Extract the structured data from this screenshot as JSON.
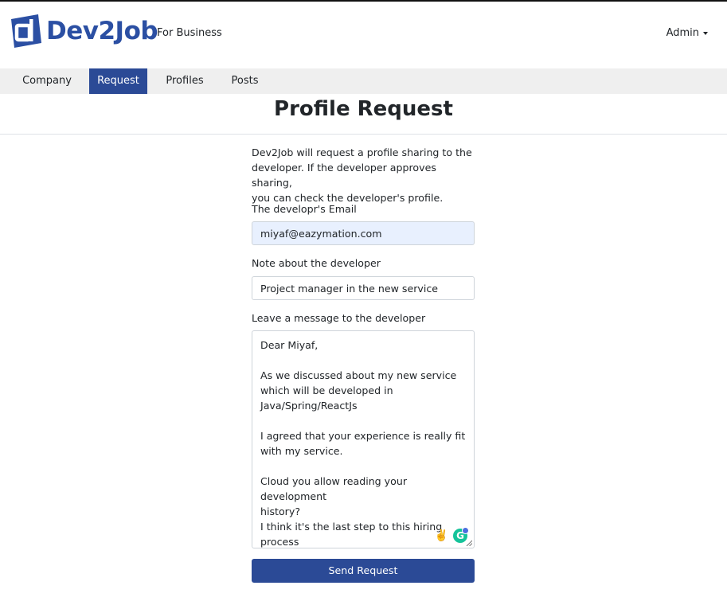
{
  "header": {
    "logo_text": "Dev2Job",
    "logo_mark": "d",
    "subtitle": "For Business",
    "admin_label": "Admin"
  },
  "nav": {
    "items": [
      {
        "label": "Company",
        "active": false
      },
      {
        "label": "Request",
        "active": true
      },
      {
        "label": "Profiles",
        "active": false
      },
      {
        "label": "Posts",
        "active": false
      }
    ]
  },
  "page": {
    "title": "Profile Request",
    "intro_lines": [
      "Dev2Job will request a profile sharing to the",
      "developer. If the developer approves sharing,",
      "you can check the developer's profile."
    ]
  },
  "form": {
    "email_label": "The developr's Email",
    "email_value": "miyaf@eazymation.com",
    "note_label": "Note about the developer",
    "note_value": "Project manager in the new service",
    "message_label": "Leave a message to the developer",
    "message_lines": [
      "Dear Miyaf,",
      "",
      "As we discussed about my new service",
      "which will be developed in",
      "Java/Spring/ReactJs",
      "",
      "I agreed that your experience is really fit",
      "with my service.",
      "",
      "Cloud you allow reading your development",
      "history?",
      "I think it's the last step to this hiring",
      "process"
    ],
    "emoji": "✌️",
    "submit_label": "Send Request"
  },
  "colors": {
    "brand": "#2b4fa3",
    "nav_active": "#2b4a96",
    "button": "#2b4a96",
    "autofill": "#e8f0fe"
  },
  "icons": [
    "dev2job-logo-icon",
    "chevron-down-icon",
    "victory-hand-icon",
    "grammarly-icon",
    "resize-handle-icon"
  ]
}
